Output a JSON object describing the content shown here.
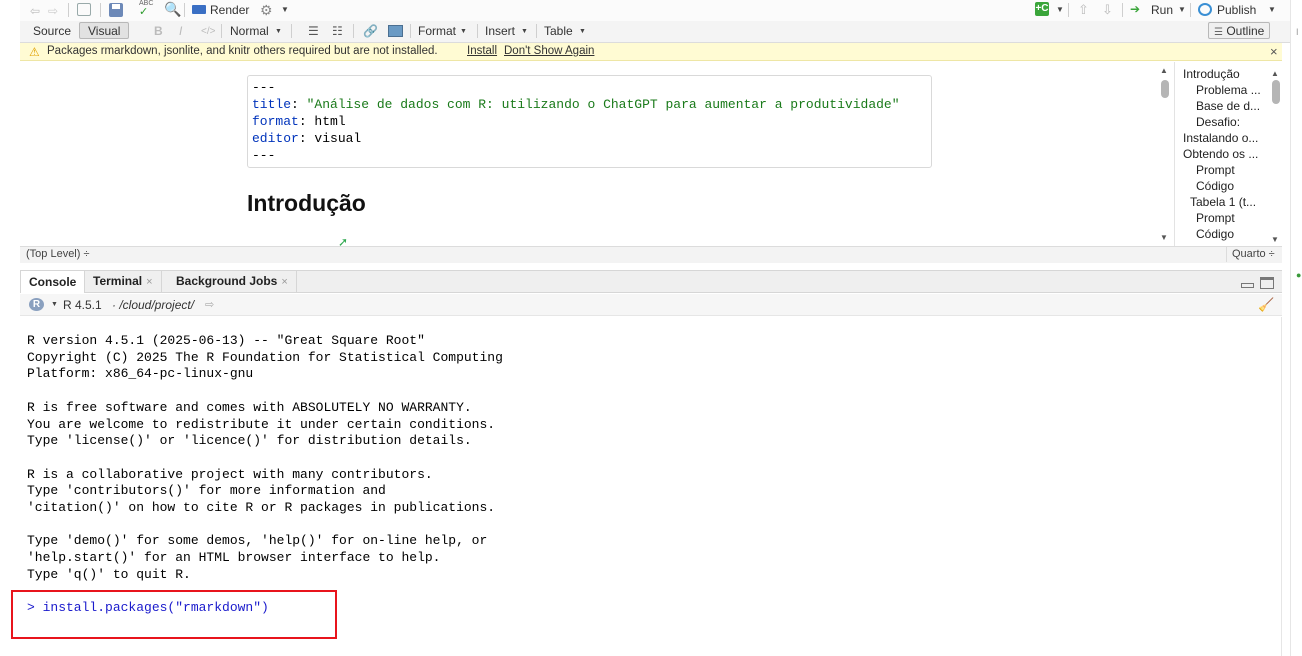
{
  "toolbar": {
    "render_label": "Render",
    "run_label": "Run",
    "publish_label": "Publish"
  },
  "format_bar": {
    "source_label": "Source",
    "visual_label": "Visual",
    "bold_label": "B",
    "italic_label": "I",
    "code_label": "</>",
    "style_label": "Normal",
    "format_label": "Format",
    "insert_label": "Insert",
    "table_label": "Table",
    "outline_label": "Outline"
  },
  "warning": {
    "message": "Packages rmarkdown, jsonlite, and knitr others required but are not installed.",
    "install_link": "Install",
    "dismiss_link": "Don't Show Again",
    "close": "×"
  },
  "yaml": {
    "delim": "---",
    "title_key": "title",
    "title_val": "\"Análise de dados com R: utilizando o ChatGPT para aumentar a produtividade\"",
    "format_key": "format",
    "format_val": "html",
    "editor_key": "editor",
    "editor_val": "visual"
  },
  "heading": "Introdução",
  "outline": {
    "items": [
      "Introdução",
      "Problema ...",
      "Base de d...",
      "Desafio:",
      "Instalando o...",
      "Obtendo os ...",
      "Prompt",
      "Código",
      "Tabela 1 (t...",
      "Prompt",
      "Código"
    ]
  },
  "statusbar": {
    "level": "(Top Level) ÷",
    "doc_type": "Quarto ÷"
  },
  "console": {
    "tabs": [
      "Console",
      "Terminal",
      "Background Jobs"
    ],
    "r_version": "R 4.5.1",
    "path": "· /cloud/project/",
    "lines": [
      "R version 4.5.1 (2025-06-13) -- \"Great Square Root\"",
      "Copyright (C) 2025 The R Foundation for Statistical Computing",
      "Platform: x86_64-pc-linux-gnu",
      "",
      "R is free software and comes with ABSOLUTELY NO WARRANTY.",
      "You are welcome to redistribute it under certain conditions.",
      "Type 'license()' or 'licence()' for distribution details.",
      "",
      "R is a collaborative project with many contributors.",
      "Type 'contributors()' for more information and",
      "'citation()' on how to cite R or R packages in publications.",
      "",
      "Type 'demo()' for some demos, 'help()' for on-line help, or",
      "'help.start()' for an HTML browser interface to help.",
      "Type 'q()' to quit R."
    ],
    "command": "> install.packages(\"rmarkdown\")"
  },
  "colors": {
    "highlight": "#e8141c",
    "warning_bg": "#fffbd3",
    "yaml_key": "#0033bb",
    "yaml_val": "#1a7a1a",
    "console_cmd": "#1a1acc"
  }
}
